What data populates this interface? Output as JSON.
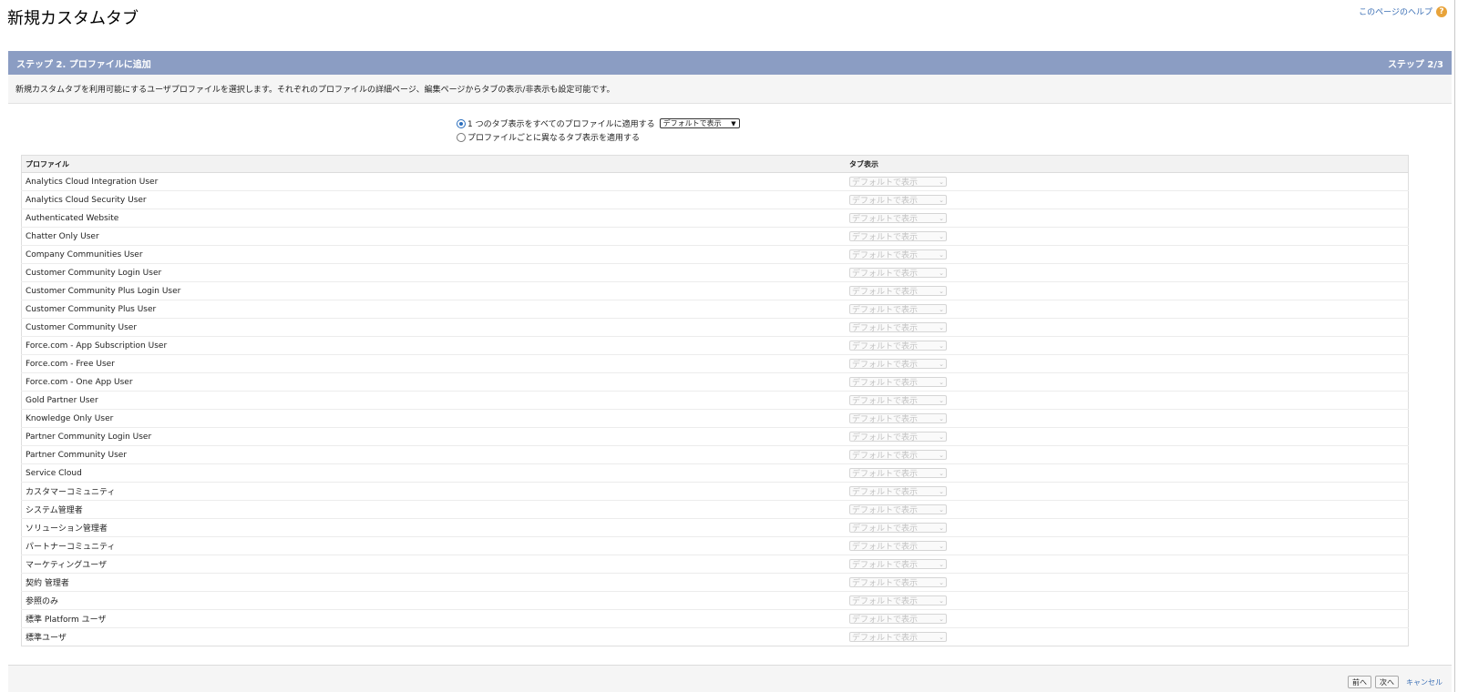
{
  "page": {
    "title": "新規カスタムタブ",
    "help_link": "このページのヘルプ",
    "help_icon": "help-icon"
  },
  "step": {
    "title": "ステップ 2. プロファイルに追加",
    "indicator": "ステップ 2/3",
    "description": "新規カスタムタブを利用可能にするユーザプロファイルを選択します。それぞれのプロファイルの詳細ページ、編集ページからタブの表示/非表示も設定可能です。"
  },
  "options": {
    "apply_all_label": "1 つのタブ表示をすべてのプロファイルに適用する",
    "apply_all_selected": true,
    "apply_all_select_value": "デフォルトで表示",
    "per_profile_label": "プロファイルごとに異なるタブ表示を適用する",
    "per_profile_selected": false
  },
  "table": {
    "headers": [
      "プロファイル",
      "タブ表示"
    ],
    "rows": [
      {
        "profile": "Analytics Cloud Integration User",
        "visibility": "デフォルトで表示"
      },
      {
        "profile": "Analytics Cloud Security User",
        "visibility": "デフォルトで表示"
      },
      {
        "profile": "Authenticated Website",
        "visibility": "デフォルトで表示"
      },
      {
        "profile": "Chatter Only User",
        "visibility": "デフォルトで表示"
      },
      {
        "profile": "Company Communities User",
        "visibility": "デフォルトで表示"
      },
      {
        "profile": "Customer Community Login User",
        "visibility": "デフォルトで表示"
      },
      {
        "profile": "Customer Community Plus Login User",
        "visibility": "デフォルトで表示"
      },
      {
        "profile": "Customer Community Plus User",
        "visibility": "デフォルトで表示"
      },
      {
        "profile": "Customer Community User",
        "visibility": "デフォルトで表示"
      },
      {
        "profile": "Force.com - App Subscription User",
        "visibility": "デフォルトで表示"
      },
      {
        "profile": "Force.com - Free User",
        "visibility": "デフォルトで表示"
      },
      {
        "profile": "Force.com - One App User",
        "visibility": "デフォルトで表示"
      },
      {
        "profile": "Gold Partner User",
        "visibility": "デフォルトで表示"
      },
      {
        "profile": "Knowledge Only User",
        "visibility": "デフォルトで表示"
      },
      {
        "profile": "Partner Community Login User",
        "visibility": "デフォルトで表示"
      },
      {
        "profile": "Partner Community User",
        "visibility": "デフォルトで表示"
      },
      {
        "profile": "Service Cloud",
        "visibility": "デフォルトで表示"
      },
      {
        "profile": "カスタマーコミュニティ",
        "visibility": "デフォルトで表示"
      },
      {
        "profile": "システム管理者",
        "visibility": "デフォルトで表示"
      },
      {
        "profile": "ソリューション管理者",
        "visibility": "デフォルトで表示"
      },
      {
        "profile": "パートナーコミュニティ",
        "visibility": "デフォルトで表示"
      },
      {
        "profile": "マーケティングユーザ",
        "visibility": "デフォルトで表示"
      },
      {
        "profile": "契約 管理者",
        "visibility": "デフォルトで表示"
      },
      {
        "profile": "参照のみ",
        "visibility": "デフォルトで表示"
      },
      {
        "profile": "標準 Platform ユーザ",
        "visibility": "デフォルトで表示"
      },
      {
        "profile": "標準ユーザ",
        "visibility": "デフォルトで表示"
      }
    ]
  },
  "buttons": {
    "prev": "前へ",
    "next": "次へ",
    "cancel": "キャンセル"
  },
  "colors": {
    "step_header_bg": "#8b9dc3",
    "link": "#3b6fb5",
    "help_icon_bg": "#e8a33a"
  }
}
